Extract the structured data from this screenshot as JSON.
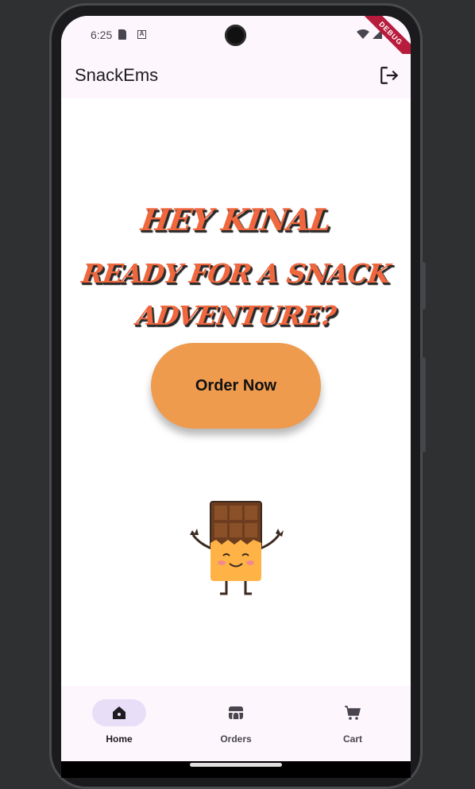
{
  "status_bar": {
    "time": "6:25",
    "debug_label": "DEBUG"
  },
  "app_bar": {
    "title": "SnackEms",
    "logout_icon": "logout-icon"
  },
  "greeting": {
    "line1": "HEY KINAL",
    "line2": "READY FOR A SNACK",
    "line3": "ADVENTURE?"
  },
  "order_button": {
    "label": "Order Now",
    "color": "#ee9b4e"
  },
  "mascot": {
    "icon": "chocolate-bar-mascot"
  },
  "bottom_nav": {
    "items": [
      {
        "label": "Home",
        "icon": "home-icon",
        "active": true
      },
      {
        "label": "Orders",
        "icon": "store-icon",
        "active": false
      },
      {
        "label": "Cart",
        "icon": "cart-icon",
        "active": false
      }
    ],
    "active_pill_color": "#e8def8"
  },
  "colors": {
    "headline": "#f0673e",
    "surface": "#fdf7fd"
  }
}
